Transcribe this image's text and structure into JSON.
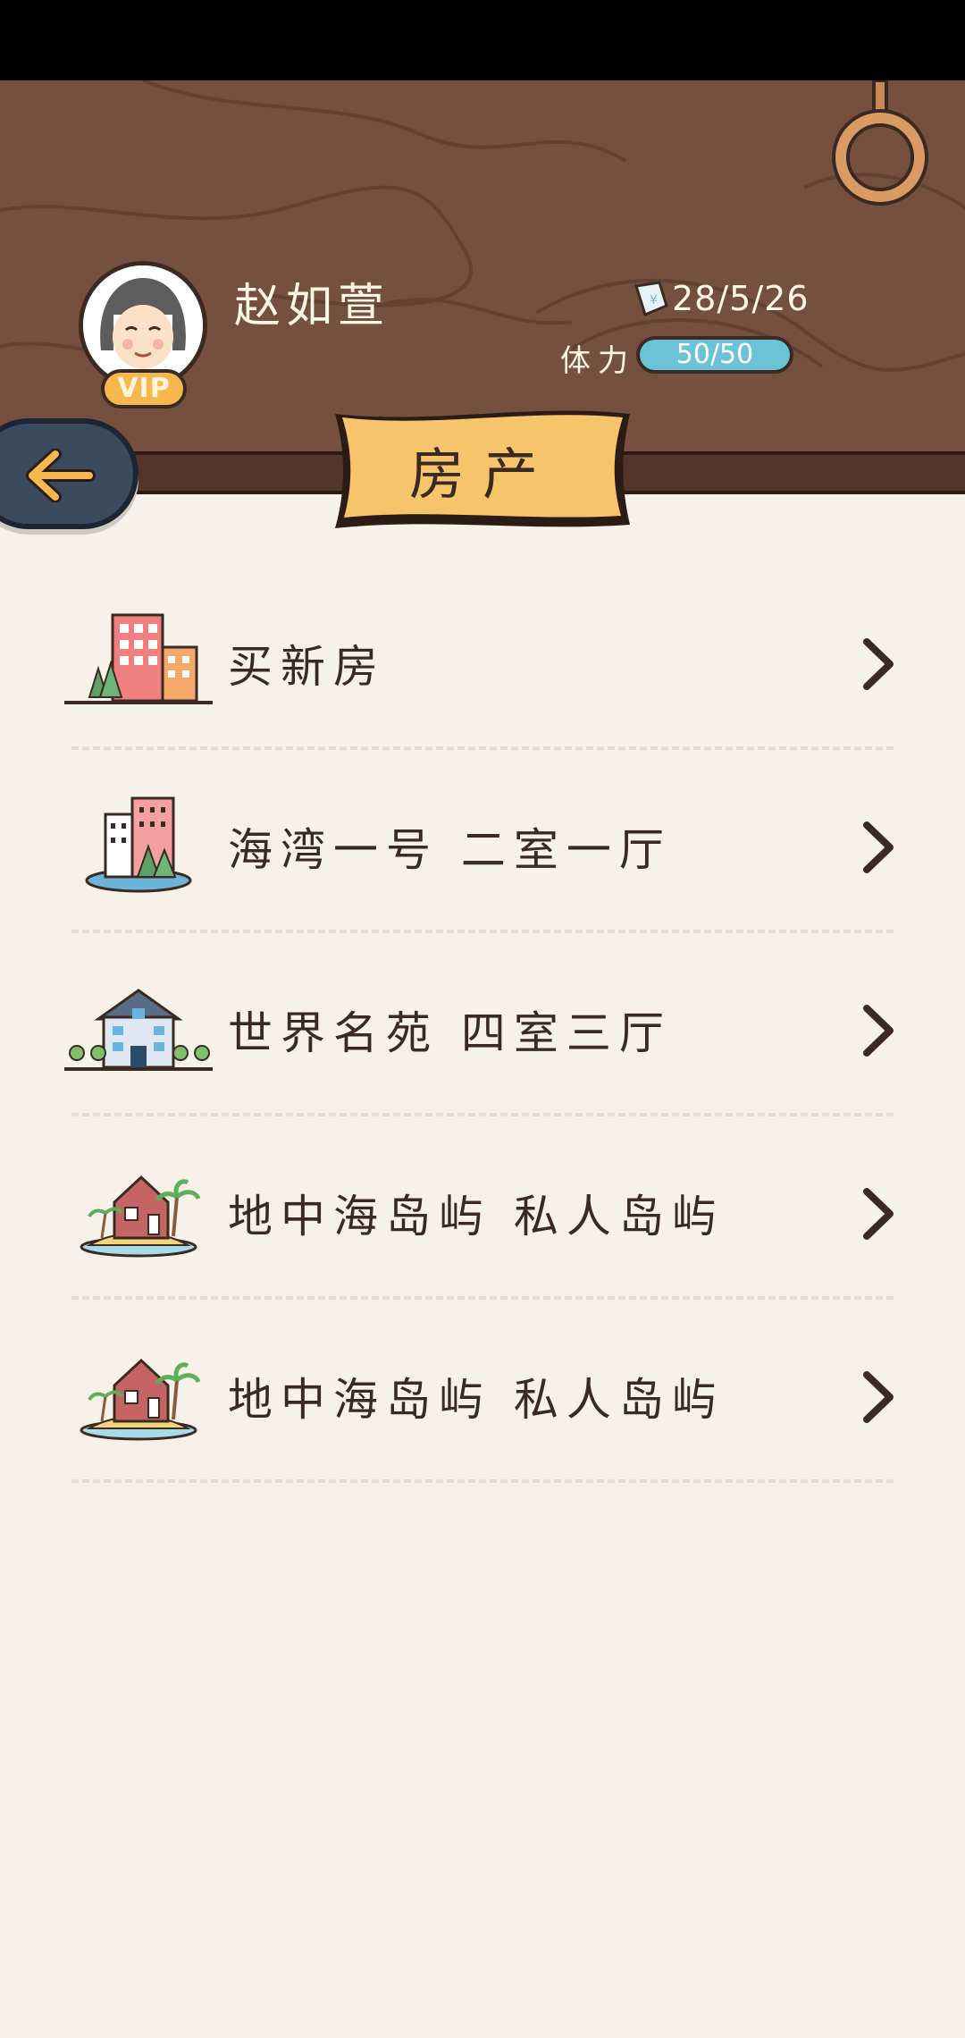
{
  "player": {
    "name": "赵如萱",
    "vip_label": "VIP",
    "money": "28/5/26",
    "stamina_label": "体力",
    "stamina_text": "50/50",
    "stamina_fraction": 1.0
  },
  "page": {
    "title": "房产"
  },
  "icons": {
    "back": "back-arrow-icon",
    "money": "money-ticket-icon",
    "ring": "hanging-ring-icon",
    "chevron": "chevron-right-icon"
  },
  "colors": {
    "wood": "#76503f",
    "paper": "#f6f2ea",
    "banner": "#f6c46a",
    "stamina": "#6cc3d8",
    "text": "#3a2a22"
  },
  "properties": [
    {
      "label": "买新房",
      "icon": "buy-new-house-icon"
    },
    {
      "label": "海湾一号 二室一厅",
      "icon": "apartment-bay-icon"
    },
    {
      "label": "世界名苑 四室三厅",
      "icon": "villa-icon"
    },
    {
      "label": "地中海岛屿 私人岛屿",
      "icon": "private-island-icon"
    },
    {
      "label": "地中海岛屿 私人岛屿",
      "icon": "private-island-icon"
    }
  ]
}
